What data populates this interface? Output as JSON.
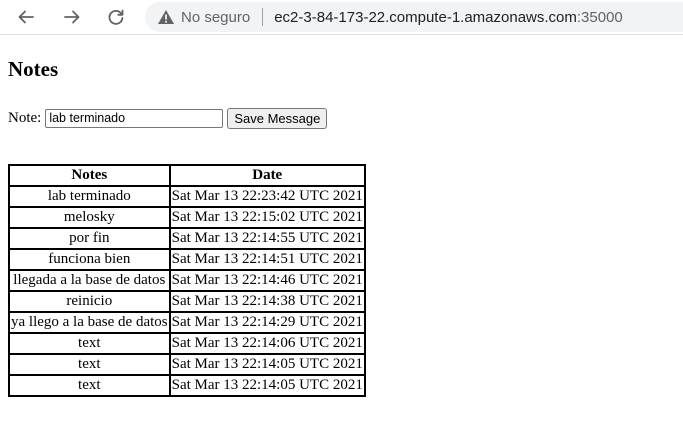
{
  "browser": {
    "security_label": "No seguro",
    "url_host": "ec2-3-84-173-22.compute-1.amazonaws.com",
    "url_port": ":35000",
    "icons": [
      "back-arrow-icon",
      "forward-arrow-icon",
      "reload-icon",
      "warning-triangle-icon"
    ]
  },
  "page": {
    "title": "Notes",
    "note_label": "Note:",
    "note_value": "lab terminado",
    "save_label": "Save Message"
  },
  "table": {
    "headers": [
      "Notes",
      "Date"
    ],
    "rows": [
      {
        "note": "lab terminado",
        "date": "Sat Mar 13 22:23:42 UTC 2021"
      },
      {
        "note": "melosky",
        "date": "Sat Mar 13 22:15:02 UTC 2021"
      },
      {
        "note": "por fin",
        "date": "Sat Mar 13 22:14:55 UTC 2021"
      },
      {
        "note": "funciona bien",
        "date": "Sat Mar 13 22:14:51 UTC 2021"
      },
      {
        "note": "llegada a la base de datos",
        "date": "Sat Mar 13 22:14:46 UTC 2021"
      },
      {
        "note": "reinicio",
        "date": "Sat Mar 13 22:14:38 UTC 2021"
      },
      {
        "note": "ya llego a la base de datos",
        "date": "Sat Mar 13 22:14:29 UTC 2021"
      },
      {
        "note": "text",
        "date": "Sat Mar 13 22:14:06 UTC 2021"
      },
      {
        "note": "text",
        "date": "Sat Mar 13 22:14:05 UTC 2021"
      },
      {
        "note": "text",
        "date": "Sat Mar 13 22:14:05 UTC 2021"
      }
    ]
  }
}
